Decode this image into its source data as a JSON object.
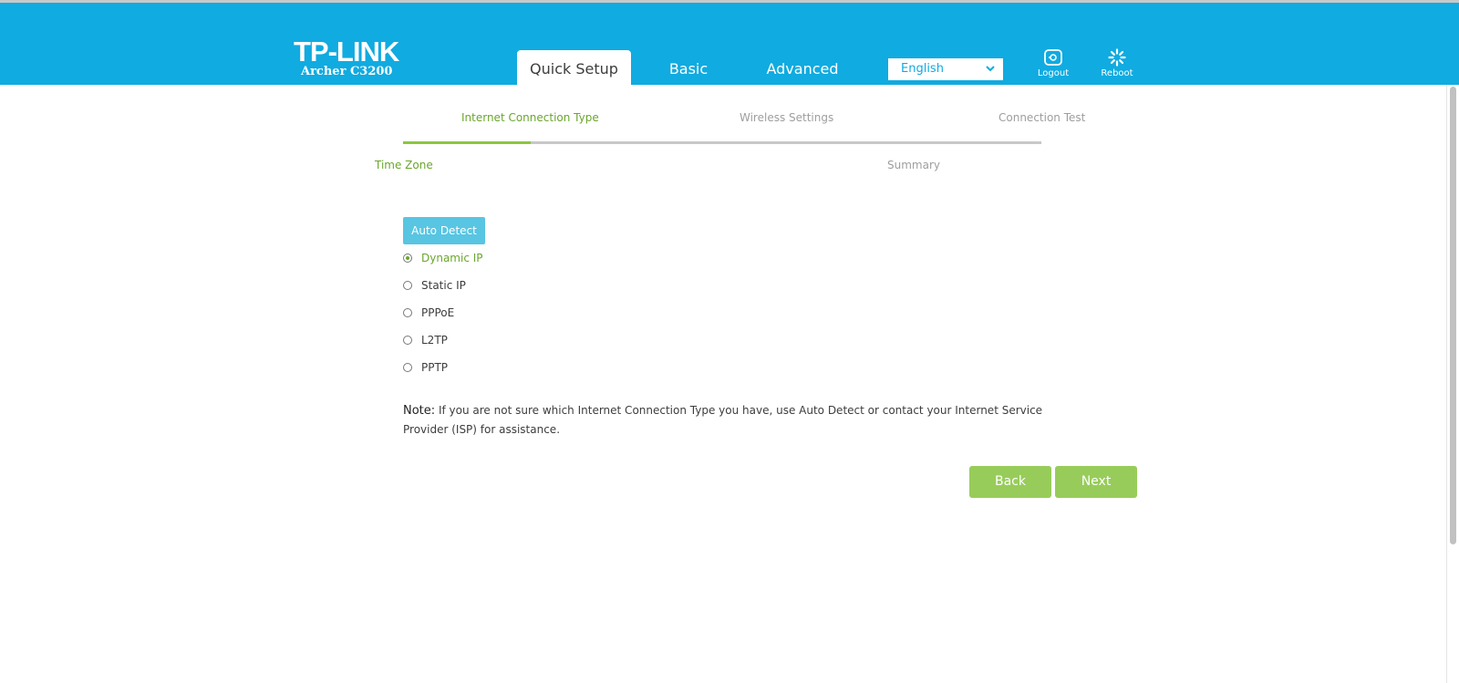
{
  "brand": {
    "logo": "TP-LINK",
    "model": "Archer C3200"
  },
  "nav": {
    "tabs": [
      {
        "label": "Quick Setup",
        "active": true
      },
      {
        "label": "Basic",
        "active": false
      },
      {
        "label": "Advanced",
        "active": false
      }
    ]
  },
  "language": {
    "selected": "English"
  },
  "header_buttons": {
    "logout": "Logout",
    "reboot": "Reboot"
  },
  "steps": {
    "items": [
      {
        "label": "Internet Connection Type",
        "active": true
      },
      {
        "label": "Wireless Settings",
        "active": false
      },
      {
        "label": "Connection Test",
        "active": false
      },
      {
        "label": "Time Zone",
        "active": true
      },
      {
        "label": "Summary",
        "active": false
      }
    ],
    "progress_fraction": 0.2
  },
  "connection": {
    "auto_detect": "Auto Detect",
    "options": [
      {
        "label": "Dynamic IP",
        "selected": true
      },
      {
        "label": "Static IP",
        "selected": false
      },
      {
        "label": "PPPoE",
        "selected": false
      },
      {
        "label": "L2TP",
        "selected": false
      },
      {
        "label": "PPTP",
        "selected": false
      }
    ]
  },
  "note": {
    "label": "Note:",
    "text": " If you are not sure which Internet Connection Type you have, use Auto Detect or contact your Internet Service Provider (ISP) for assistance."
  },
  "actions": {
    "back": "Back",
    "next": "Next"
  },
  "colors": {
    "header": "#10abe0",
    "accent_green": "#8dc63f",
    "button_green": "#98cc5a",
    "auto_detect": "#58c5e2"
  }
}
